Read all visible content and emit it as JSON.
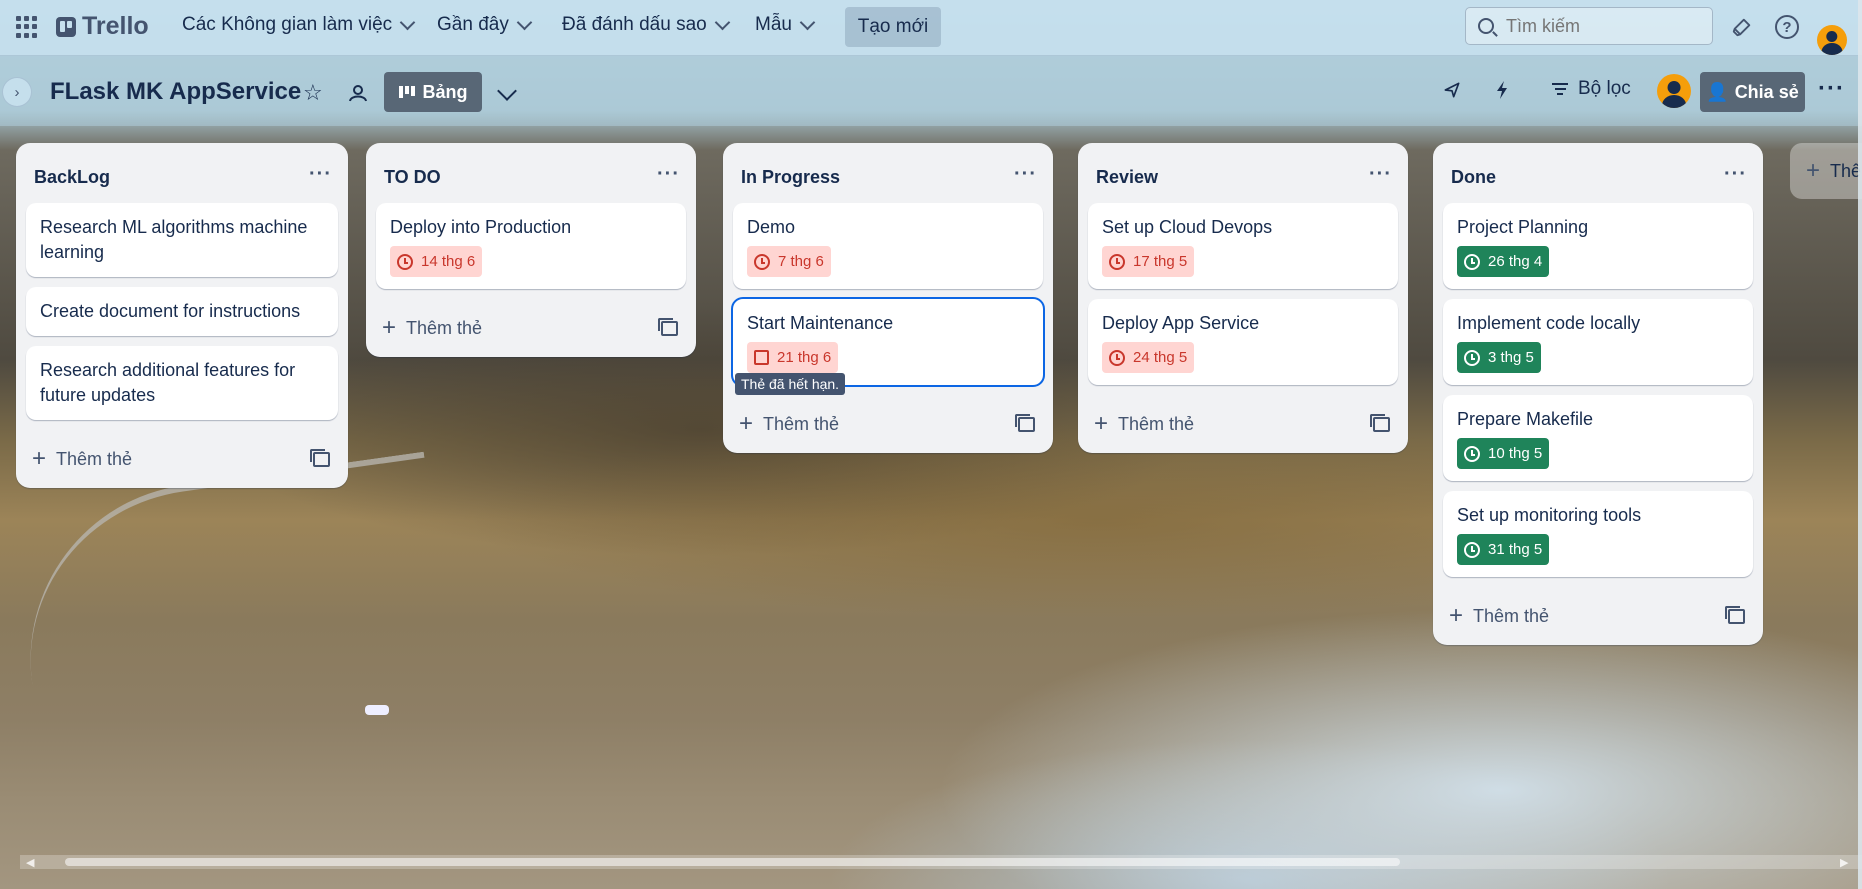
{
  "topbar": {
    "app_name": "Trello",
    "nav": [
      {
        "label": "Các Không gian làm việc"
      },
      {
        "label": "Gần đây"
      },
      {
        "label": "Đã đánh dấu sao"
      },
      {
        "label": "Mẫu"
      }
    ],
    "create_label": "Tạo mới",
    "search_placeholder": "Tìm kiếm",
    "icons": [
      "apps-grid-icon",
      "trello-logo-icon",
      "megaphone-icon",
      "help-icon",
      "avatar"
    ]
  },
  "board": {
    "title": "FLask MK AppService",
    "view_label": "Bảng",
    "filter_label": "Bộ lọc",
    "share_label": "Chia sẻ",
    "icons": [
      "star-icon",
      "workspace-visible-icon",
      "board-view-icon",
      "power-ups-icon",
      "automation-icon",
      "filter-icon",
      "more-icon"
    ]
  },
  "lists": [
    {
      "title": "BackLog",
      "cards": [
        {
          "title": "Research ML algorithms machine learning"
        },
        {
          "title": "Create document for instructions"
        },
        {
          "title": "Research additional features for future updates"
        }
      ],
      "add_label": "Thêm thẻ"
    },
    {
      "title": "TO DO",
      "cards": [
        {
          "title": "Deploy into Production",
          "due": "14 thg 6",
          "status": "overdue"
        }
      ],
      "add_label": "Thêm thẻ"
    },
    {
      "title": "In Progress",
      "cards": [
        {
          "title": "Demo",
          "due": "7 thg 6",
          "status": "overdue"
        },
        {
          "title": "Start Maintenance",
          "due": "21 thg 6",
          "status": "overdue"
        }
      ],
      "add_label": "Thêm thẻ",
      "tooltip": "Thẻ đã hết hạn."
    },
    {
      "title": "Review",
      "cards": [
        {
          "title": "Set up Cloud Devops",
          "due": "17 thg 5",
          "status": "overdue"
        },
        {
          "title": "Deploy App Service",
          "due": "24 thg 5",
          "status": "overdue"
        }
      ],
      "add_label": "Thêm thẻ"
    },
    {
      "title": "Done",
      "cards": [
        {
          "title": "Project Planning",
          "due": "26 thg 4",
          "status": "complete"
        },
        {
          "title": "Implement code locally",
          "due": "3 thg 5",
          "status": "complete"
        },
        {
          "title": "Prepare Makefile",
          "due": "10 thg 5",
          "status": "complete"
        },
        {
          "title": "Set up monitoring tools",
          "due": "31 thg 5",
          "status": "complete"
        }
      ],
      "add_label": "Thêm thẻ"
    }
  ],
  "add_list_label": "Thêm",
  "colors": {
    "overdue_bg": "#ffd5d2",
    "overdue_text": "#c9372c",
    "complete_bg": "#1f845a",
    "selected_outline": "#0c66e4"
  }
}
